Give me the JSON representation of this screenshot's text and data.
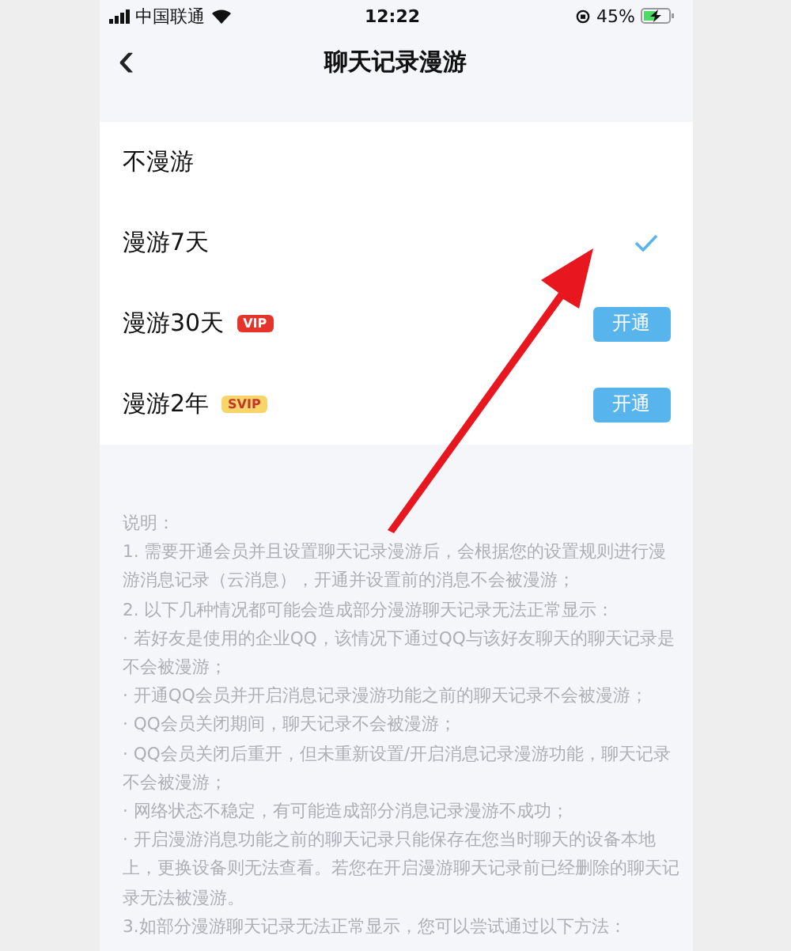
{
  "status_bar": {
    "carrier": "中国联通",
    "time": "12:22",
    "battery": "45%",
    "charging": true
  },
  "nav": {
    "back": "‹",
    "title": "聊天记录漫游"
  },
  "options": [
    {
      "label": "不漫游",
      "selected": false
    },
    {
      "label": "漫游7天",
      "selected": true
    },
    {
      "label": "漫游30天",
      "badge": {
        "kind": "vip",
        "text": "VIP"
      },
      "button": "开通",
      "selected": false
    },
    {
      "label": "漫游2年",
      "badge": {
        "kind": "svip",
        "text": "SVIP"
      },
      "button": "开通",
      "selected": false
    }
  ],
  "notes": [
    "说明：",
    "1. 需要开通会员并且设置聊天记录漫游后，会根据您的设置规则进行漫游消息记录（云消息），开通并设置前的消息不会被漫游；",
    "2. 以下几种情况都可能会造成部分漫游聊天记录无法正常显示：",
    "· 若好友是使用的企业QQ，该情况下通过QQ与该好友聊天的聊天记录是不会被漫游；",
    "· 开通QQ会员并开启消息记录漫游功能之前的聊天记录不会被漫游；",
    "· QQ会员关闭期间，聊天记录不会被漫游；",
    "· QQ会员关闭后重开，但未重新设置/开启消息记录漫游功能，聊天记录不会被漫游；",
    "· 网络状态不稳定，有可能造成部分消息记录漫游不成功；",
    "· 开启漫游消息功能之前的聊天记录只能保存在您当时聊天的设备本地上，更换设备则无法查看。若您在开启漫游聊天记录前已经删除的聊天记录无法被漫游。",
    "3.如部分漫游聊天记录无法正常显示，您可以尝试通过以下方法："
  ]
}
